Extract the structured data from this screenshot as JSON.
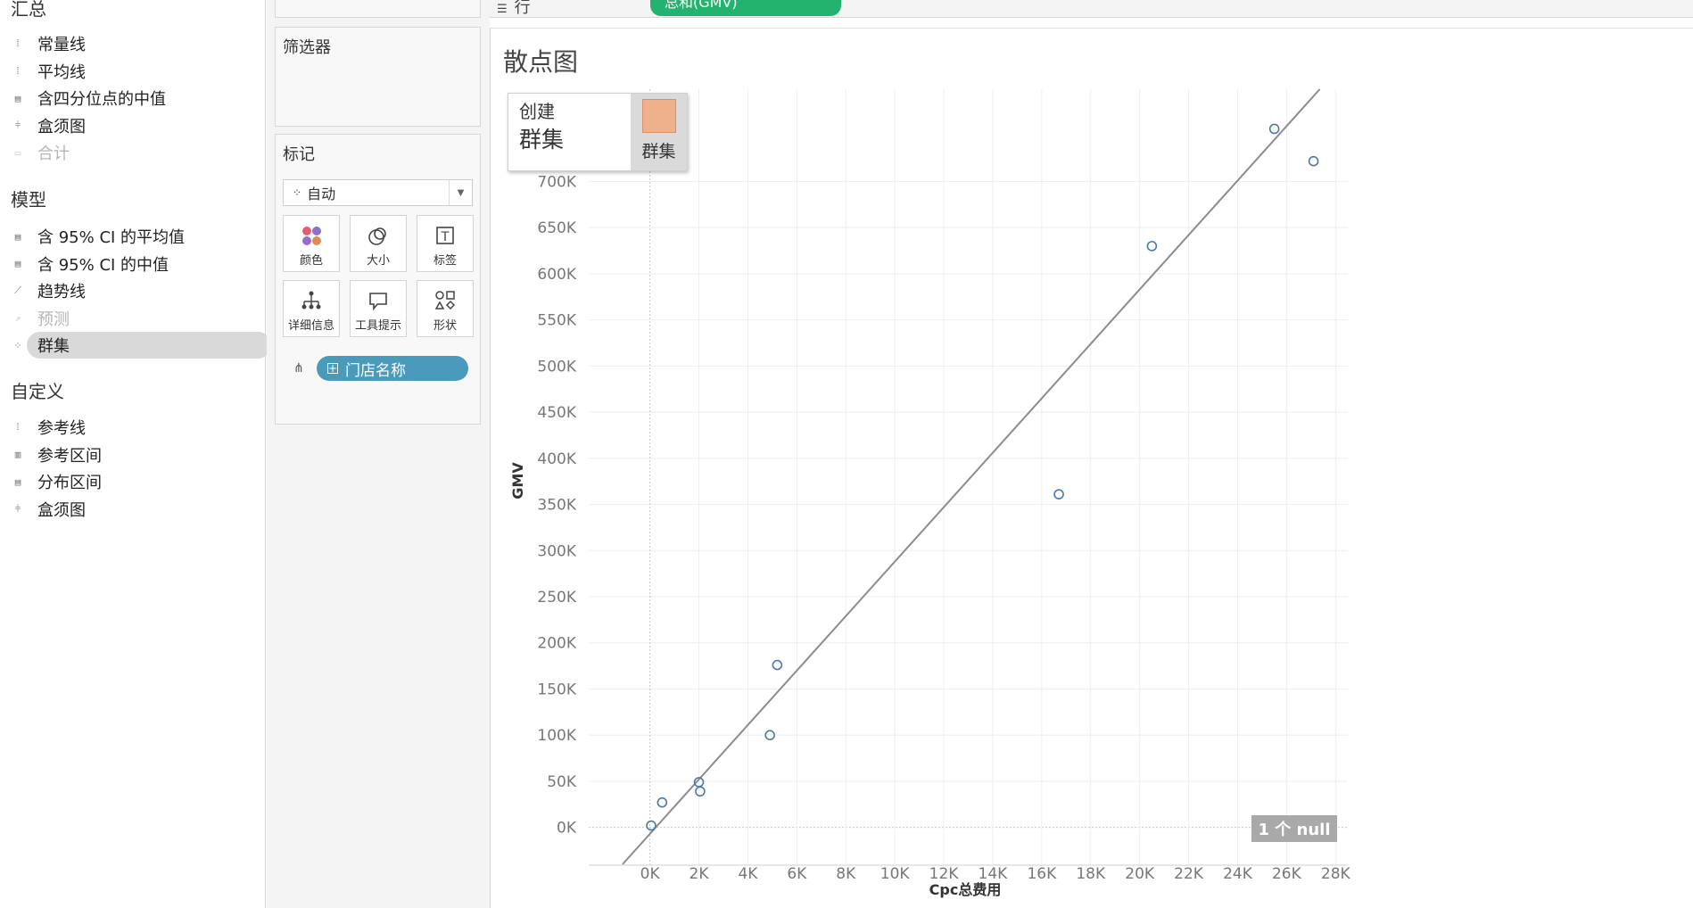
{
  "analytics": {
    "summary": {
      "title": "汇总",
      "items": [
        {
          "label": "常量线",
          "icon": "constant-line-icon"
        },
        {
          "label": "平均线",
          "icon": "average-line-icon"
        },
        {
          "label": "含四分位点的中值",
          "icon": "median-quartiles-icon"
        },
        {
          "label": "盒须图",
          "icon": "box-plot-icon"
        },
        {
          "label": "合计",
          "icon": "totals-icon",
          "disabled": true
        }
      ]
    },
    "model": {
      "title": "模型",
      "items": [
        {
          "label": "含 95% CI 的平均值",
          "icon": "average-ci-icon"
        },
        {
          "label": "含 95% CI 的中值",
          "icon": "median-ci-icon"
        },
        {
          "label": "趋势线",
          "icon": "trend-line-icon"
        },
        {
          "label": "预测",
          "icon": "forecast-icon",
          "disabled": true
        },
        {
          "label": "群集",
          "icon": "cluster-icon",
          "selected": true
        }
      ]
    },
    "custom": {
      "title": "自定义",
      "items": [
        {
          "label": "参考线",
          "icon": "reference-line-icon"
        },
        {
          "label": "参考区间",
          "icon": "reference-band-icon"
        },
        {
          "label": "分布区间",
          "icon": "distribution-band-icon"
        },
        {
          "label": "盒须图",
          "icon": "box-plot-icon"
        }
      ]
    }
  },
  "filters": {
    "title": "筛选器"
  },
  "marks": {
    "title": "标记",
    "type": "自动",
    "buttons": [
      {
        "label": "颜色",
        "icon": "color-icon"
      },
      {
        "label": "大小",
        "icon": "size-icon"
      },
      {
        "label": "标签",
        "icon": "label-icon"
      },
      {
        "label": "详细信息",
        "icon": "detail-icon"
      },
      {
        "label": "工具提示",
        "icon": "tooltip-icon"
      },
      {
        "label": "形状",
        "icon": "shape-icon"
      }
    ],
    "detail_field": "门店名称"
  },
  "rows_shelf": {
    "label": "行",
    "pill": "总和(GMV)"
  },
  "sheet": {
    "title": "散点图"
  },
  "cluster_popup": {
    "line1": "创建",
    "line2": "群集",
    "tile_label": "群集"
  },
  "null_badge": "1 个 null",
  "colors": {
    "point": "#4e79a7",
    "trend": "#8c8c8c",
    "rows_pill": "#23b36e",
    "detail_pill": "#4a9bbb"
  },
  "chart_data": {
    "type": "scatter",
    "title": "散点图",
    "xlabel": "Cpc总费用",
    "ylabel": "GMV",
    "xlim": [
      -2500,
      28500
    ],
    "ylim": [
      -40000,
      800000
    ],
    "xticks": [
      "0K",
      "2K",
      "4K",
      "6K",
      "8K",
      "10K",
      "12K",
      "14K",
      "16K",
      "18K",
      "20K",
      "22K",
      "24K",
      "26K",
      "28K"
    ],
    "xtick_values": [
      0,
      2000,
      4000,
      6000,
      8000,
      10000,
      12000,
      14000,
      16000,
      18000,
      20000,
      22000,
      24000,
      26000,
      28000
    ],
    "yticks": [
      "0K",
      "50K",
      "100K",
      "150K",
      "200K",
      "250K",
      "300K",
      "350K",
      "400K",
      "450K",
      "500K",
      "550K",
      "600K",
      "650K",
      "700K"
    ],
    "ytick_values": [
      0,
      50000,
      100000,
      150000,
      200000,
      250000,
      300000,
      350000,
      400000,
      450000,
      500000,
      550000,
      600000,
      650000,
      700000
    ],
    "points": [
      {
        "x": 50,
        "y": 2000
      },
      {
        "x": 500,
        "y": 27000
      },
      {
        "x": 2000,
        "y": 49000
      },
      {
        "x": 2050,
        "y": 39000
      },
      {
        "x": 4900,
        "y": 100000
      },
      {
        "x": 5200,
        "y": 176000
      },
      {
        "x": 16700,
        "y": 361000
      },
      {
        "x": 20500,
        "y": 630000
      },
      {
        "x": 25500,
        "y": 757000
      },
      {
        "x": 27100,
        "y": 722000
      }
    ],
    "trend_line": {
      "slope": 29.5,
      "intercept": -7000
    },
    "grid": true
  }
}
